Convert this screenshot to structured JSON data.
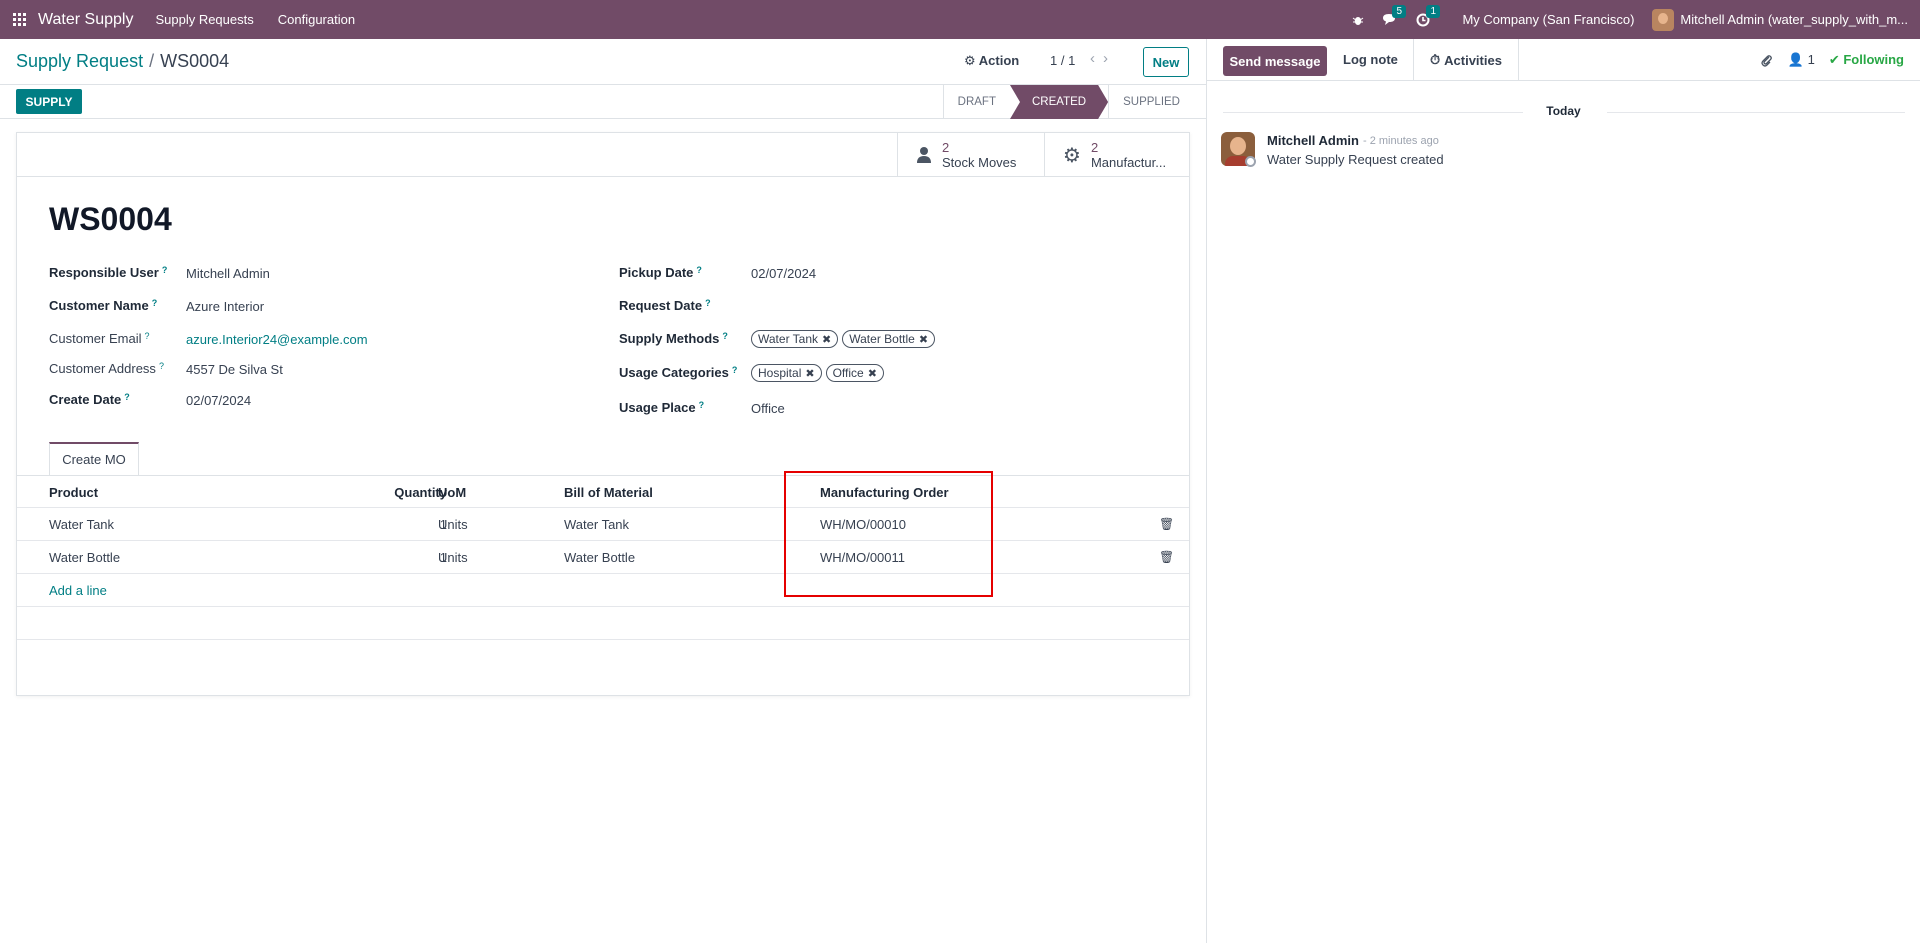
{
  "navbar": {
    "app_name": "Water Supply",
    "menus": [
      "Supply Requests",
      "Configuration"
    ],
    "messages_count": "5",
    "activities_count": "1",
    "company": "My Company (San Francisco)",
    "user": "Mitchell Admin (water_supply_with_m..."
  },
  "breadcrumb": {
    "parent": "Supply Request",
    "separator": "/",
    "current": "WS0004"
  },
  "control": {
    "action_label": "Action",
    "pager": "1 / 1",
    "new_label": "New"
  },
  "statusbar": {
    "supply_label": "SUPPLY",
    "stages": [
      "DRAFT",
      "CREATED",
      "SUPPLIED"
    ],
    "active_stage": "CREATED"
  },
  "smart_buttons": {
    "stock_moves": {
      "value": "2",
      "label": "Stock Moves"
    },
    "manufacturing": {
      "value": "2",
      "label": "Manufactur..."
    }
  },
  "record": {
    "title": "WS0004",
    "left_fields": [
      {
        "label": "Responsible User",
        "value": "Mitchell Admin"
      },
      {
        "label": "Customer Name",
        "value": "Azure Interior"
      },
      {
        "label": "Customer Email",
        "value": "azure.Interior24@example.com"
      },
      {
        "label": "Customer Address",
        "value": "4557 De Silva St"
      },
      {
        "label": "Create Date",
        "value": "02/07/2024"
      }
    ],
    "right_fields": [
      {
        "label": "Pickup Date",
        "value": "02/07/2024"
      },
      {
        "label": "Request Date",
        "value": ""
      },
      {
        "label": "Supply Methods",
        "tags": [
          "Water Tank",
          "Water Bottle"
        ]
      },
      {
        "label": "Usage Categories",
        "tags": [
          "Hospital",
          "Office"
        ]
      },
      {
        "label": "Usage Place",
        "value": "Office"
      }
    ],
    "help_mark": "?"
  },
  "notebook": {
    "tab_label": "Create MO",
    "columns": {
      "product": "Product",
      "quantity": "Quantity",
      "uom": "UoM",
      "bom": "Bill of Material",
      "mo": "Manufacturing Order"
    },
    "rows": [
      {
        "product": "Water Tank",
        "quantity": "1",
        "uom": "Units",
        "bom": "Water Tank",
        "mo": "WH/MO/00010"
      },
      {
        "product": "Water Bottle",
        "quantity": "1",
        "uom": "Units",
        "bom": "Water Bottle",
        "mo": "WH/MO/00011"
      }
    ],
    "add_line": "Add a line"
  },
  "chatter": {
    "send_message": "Send message",
    "log_note": "Log note",
    "activities": "Activities",
    "followers_count": "1",
    "following": "Following",
    "date_separator": "Today",
    "message": {
      "author": "Mitchell Admin",
      "time": "- 2 minutes ago",
      "body": "Water Supply Request created"
    }
  },
  "icons": {
    "apps": "apps-grid-icon",
    "debug": "bug-icon",
    "messages": "chat-icon",
    "activities": "clock-icon",
    "action": "gear-icon",
    "stock_moves": "user-icon",
    "manufacturing": "cog-icon",
    "attachment": "paperclip-icon",
    "followers": "person-icon",
    "following": "check-icon",
    "delete": "trash-icon"
  },
  "colors": {
    "brand": "#714b67",
    "accent": "#017e84",
    "highlight": "#e50000",
    "following": "#28a745"
  }
}
